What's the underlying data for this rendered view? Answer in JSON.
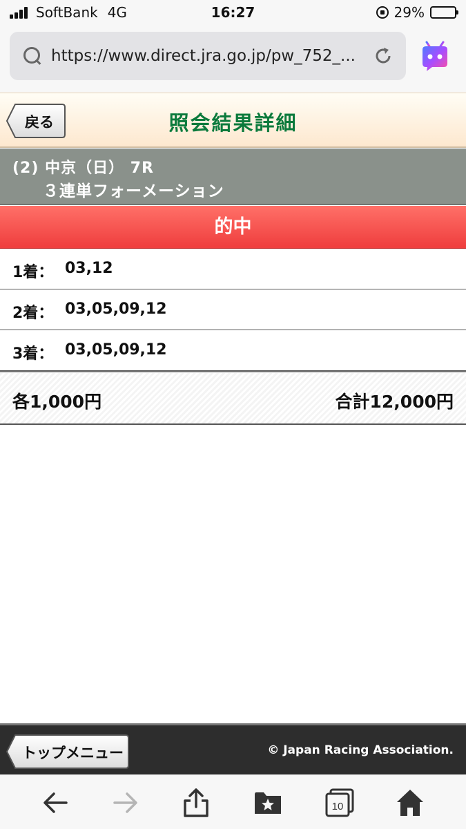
{
  "status_bar": {
    "carrier": "SoftBank",
    "network": "4G",
    "time": "16:27",
    "battery": "29%",
    "battery_level": 0.29
  },
  "browser": {
    "url": "https://www.direct.jra.go.jp/pw_752_...",
    "tab_count": "10"
  },
  "header": {
    "back_label": "戻る",
    "title": "照会結果詳細"
  },
  "race": {
    "line1": "(2) 中京（日） 7R",
    "line2": "３連単フォーメーション"
  },
  "result": {
    "banner": "的中"
  },
  "picks": [
    {
      "label": "1着：",
      "value": "03,12"
    },
    {
      "label": "2着：",
      "value": "03,05,09,12"
    },
    {
      "label": "3着：",
      "value": "03,05,09,12"
    }
  ],
  "summary": {
    "each": "各1,000円",
    "total": "合計12,000円"
  },
  "footer": {
    "top_menu_label": "トップメニュー",
    "copyright": "© Japan Racing Association."
  },
  "colors": {
    "title_green": "#0b7a3c",
    "banner_red": "#ef3d3d",
    "race_bar_gray": "#8a918b",
    "footer_dark": "#2d2d2d"
  },
  "icons": {
    "url_search": "search-icon",
    "url_reload": "reload-icon",
    "assistant": "assistant-bot-icon",
    "toolbar": [
      "back-arrow-icon",
      "forward-arrow-icon",
      "share-icon",
      "bookmarks-icon",
      "tabs-icon",
      "home-icon"
    ]
  }
}
